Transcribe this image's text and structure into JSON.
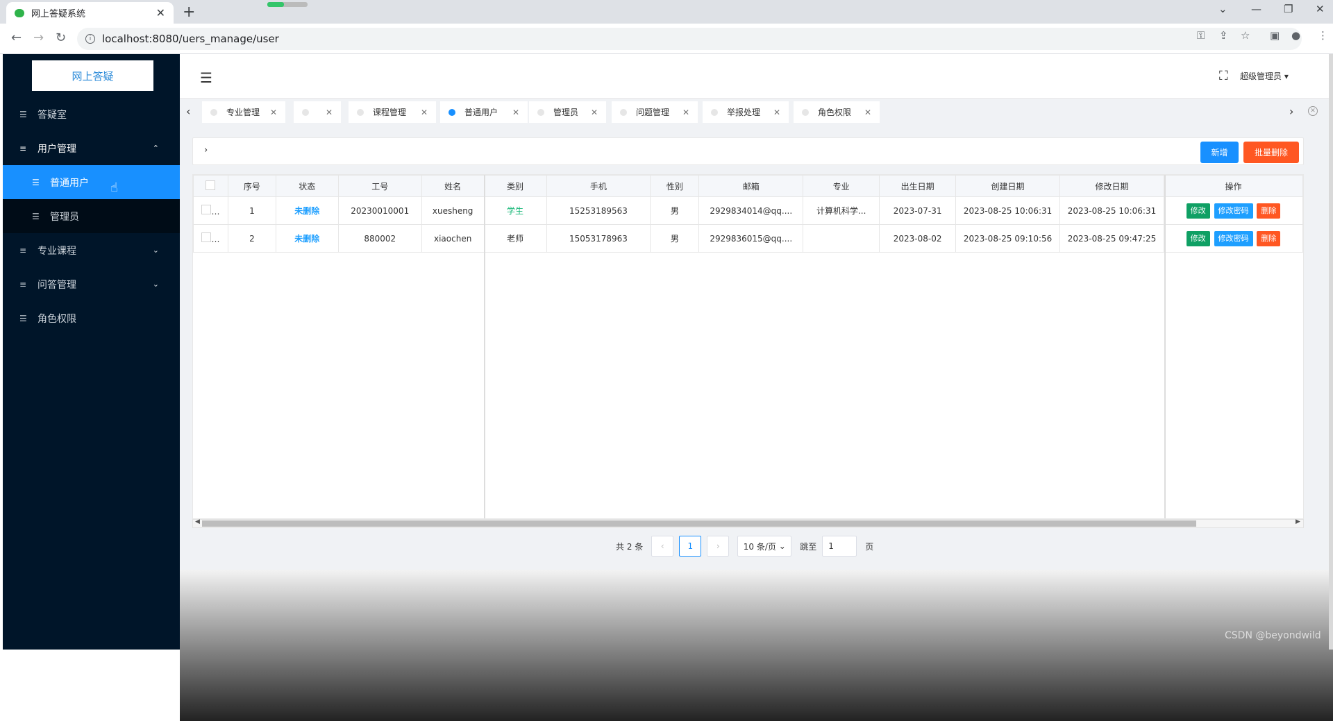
{
  "browser": {
    "tab_title": "网上答疑系统",
    "tab_close": "✕",
    "new_tab": "+",
    "url": "localhost:8080/uers_manage/user",
    "back": "←",
    "forward": "→",
    "reload": "↻"
  },
  "sidebar": {
    "logo": "网上答疑",
    "items": [
      {
        "label": "答疑室",
        "icon": "filter-icon"
      },
      {
        "label": "用户管理",
        "icon": "menu-icon",
        "chevron": "⌃"
      },
      {
        "label": "普通用户",
        "icon": "filter-icon"
      },
      {
        "label": "管理员",
        "icon": "filter-icon"
      },
      {
        "label": "专业课程",
        "icon": "menu-icon",
        "chevron": "⌄"
      },
      {
        "label": "问答管理",
        "icon": "menu-icon",
        "chevron": "⌄"
      },
      {
        "label": "角色权限",
        "icon": "filter-icon"
      }
    ]
  },
  "header": {
    "user": "超级管理员"
  },
  "tabs": [
    {
      "label": "专业管理"
    },
    {
      "label": ""
    },
    {
      "label": "课程管理"
    },
    {
      "label": "普通用户"
    },
    {
      "label": "管理员"
    },
    {
      "label": "问题管理"
    },
    {
      "label": "举报处理"
    },
    {
      "label": "角色权限"
    }
  ],
  "toolbar": {
    "add_label": "新增",
    "batch_delete_label": "批量删除"
  },
  "table": {
    "columns": [
      "",
      "序号",
      "状态",
      "工号",
      "姓名",
      "类别",
      "手机",
      "性别",
      "邮箱",
      "专业",
      "出生日期",
      "创建日期",
      "修改日期",
      "操作"
    ],
    "rows": [
      {
        "no": "1",
        "status": "未删除",
        "id": "20230010001",
        "name": "xuesheng",
        "type": "学生",
        "phone": "15253189563",
        "gender": "男",
        "email": "2929834014@qq....",
        "major": "计算机科学...",
        "birth": "2023-07-31",
        "created": "2023-08-25 10:06:31",
        "modified": "2023-08-25 10:06:31"
      },
      {
        "no": "2",
        "status": "未删除",
        "id": "880002",
        "name": "xiaochen",
        "type": "老师",
        "phone": "15053178963",
        "gender": "男",
        "email": "2929836015@qq....",
        "major": "",
        "birth": "2023-08-02",
        "created": "2023-08-25 09:10:56",
        "modified": "2023-08-25 09:47:25"
      }
    ],
    "actions": {
      "edit": "修改",
      "password": "修改密码",
      "delete": "删除"
    }
  },
  "pager": {
    "total": "共 2 条",
    "current": "1",
    "page_size": "10 条/页",
    "jump_label": "跳至",
    "jump_value": "1",
    "page_unit": "页"
  },
  "watermark": "CSDN @beyondwild",
  "colors": {
    "sidebar": "#001529",
    "active": "#1890ff",
    "danger": "#ff5722",
    "success": "#0fa064"
  }
}
